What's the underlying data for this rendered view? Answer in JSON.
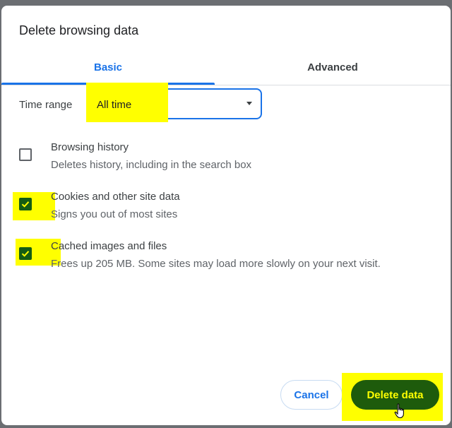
{
  "dialog": {
    "title": "Delete browsing data"
  },
  "tabs": [
    {
      "label": "Basic",
      "active": true
    },
    {
      "label": "Advanced",
      "active": false
    }
  ],
  "time_range": {
    "label": "Time range",
    "value": "All time"
  },
  "items": [
    {
      "title": "Browsing history",
      "subtitle": "Deletes history, including in the search box",
      "checked": false
    },
    {
      "title": "Cookies and other site data",
      "subtitle": "Signs you out of most sites",
      "checked": true
    },
    {
      "title": "Cached images and files",
      "subtitle": "Frees up 205 MB. Some sites may load more slowly on your next visit.",
      "checked": true
    }
  ],
  "footer": {
    "cancel_label": "Cancel",
    "delete_label": "Delete data"
  },
  "colors": {
    "accent": "#1a73e8",
    "checkbox_checked": "#145c14",
    "delete_button": "#1e5b0c",
    "highlight": "#ffff00"
  },
  "icons": {
    "dropdown": "caret-down-icon",
    "check": "check-icon",
    "cursor": "hand-pointer-icon"
  }
}
